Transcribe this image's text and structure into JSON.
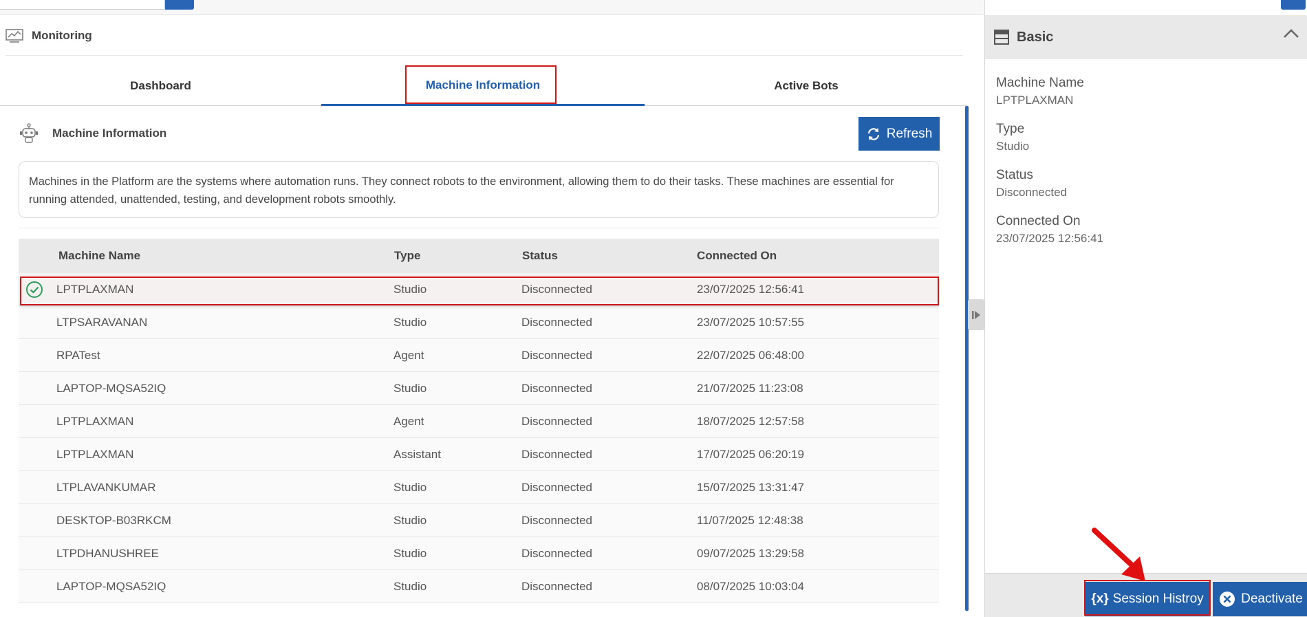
{
  "page": {
    "section_title": "Monitoring"
  },
  "tabs": [
    {
      "label": "Dashboard",
      "active": false
    },
    {
      "label": "Machine Information",
      "active": true
    },
    {
      "label": "Active Bots",
      "active": false
    }
  ],
  "machine_info": {
    "title": "Machine Information",
    "refresh_label": "Refresh",
    "description": "Machines in the Platform are the systems where automation runs. They connect robots to the environment, allowing them to do their tasks. These machines are essential for running attended, unattended, testing, and development robots smoothly."
  },
  "table": {
    "columns": [
      "Machine Name",
      "Type",
      "Status",
      "Connected On"
    ],
    "rows": [
      {
        "name": "LPTPLAXMAN",
        "type": "Studio",
        "status": "Disconnected",
        "connected": "23/07/2025 12:56:41",
        "selected": true
      },
      {
        "name": "LTPSARAVANAN",
        "type": "Studio",
        "status": "Disconnected",
        "connected": "23/07/2025 10:57:55"
      },
      {
        "name": "RPATest",
        "type": "Agent",
        "status": "Disconnected",
        "connected": "22/07/2025 06:48:00"
      },
      {
        "name": "LAPTOP-MQSA52IQ",
        "type": "Studio",
        "status": "Disconnected",
        "connected": "21/07/2025 11:23:08"
      },
      {
        "name": "LPTPLAXMAN",
        "type": "Agent",
        "status": "Disconnected",
        "connected": "18/07/2025 12:57:58"
      },
      {
        "name": "LPTPLAXMAN",
        "type": "Assistant",
        "status": "Disconnected",
        "connected": "17/07/2025 06:20:19"
      },
      {
        "name": "LTPLAVANKUMAR",
        "type": "Studio",
        "status": "Disconnected",
        "connected": "15/07/2025 13:31:47"
      },
      {
        "name": "DESKTOP-B03RKCM",
        "type": "Studio",
        "status": "Disconnected",
        "connected": "11/07/2025 12:48:38"
      },
      {
        "name": "LTPDHANUSHREE",
        "type": "Studio",
        "status": "Disconnected",
        "connected": "09/07/2025 13:29:58"
      },
      {
        "name": "LAPTOP-MQSA52IQ",
        "type": "Studio",
        "status": "Disconnected",
        "connected": "08/07/2025 10:03:04"
      }
    ]
  },
  "side_panel": {
    "section": "Basic",
    "fields": [
      {
        "label": "Machine Name",
        "value": "LPTPLAXMAN"
      },
      {
        "label": "Type",
        "value": "Studio"
      },
      {
        "label": "Status",
        "value": "Disconnected"
      },
      {
        "label": "Connected On",
        "value": "23/07/2025 12:56:41"
      }
    ],
    "session_history_icon": "{x}",
    "session_history_label": "Session Histroy",
    "deactivate_label": "Deactivate"
  },
  "colors": {
    "accent": "#2260ac",
    "highlight": "#d01818",
    "success": "#2e9c5a"
  }
}
